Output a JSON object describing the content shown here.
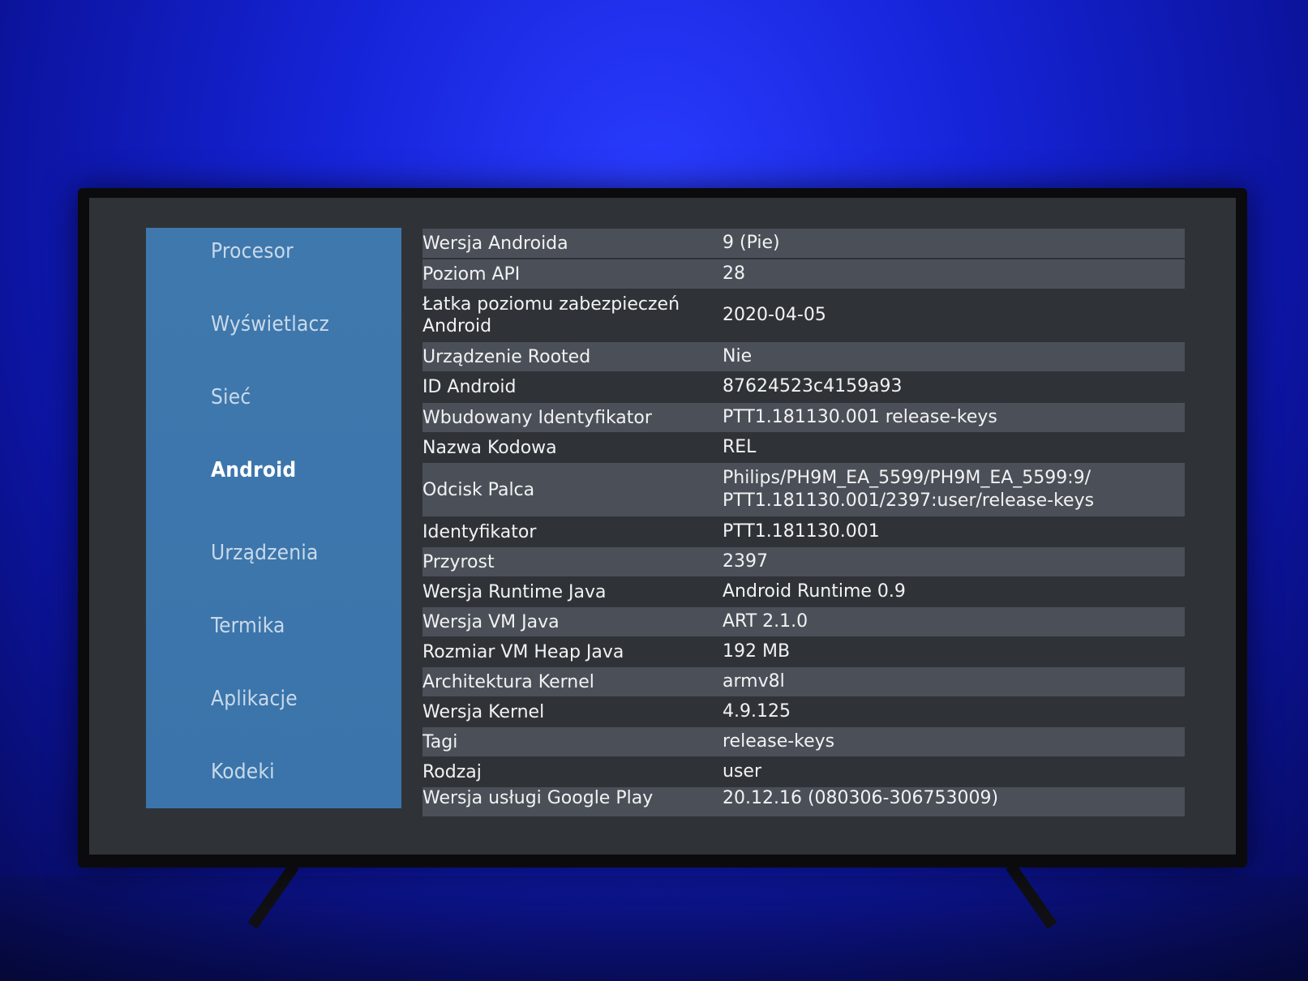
{
  "sidebar": {
    "items": [
      {
        "label": "Procesor",
        "active": false
      },
      {
        "label": "Wyświetlacz",
        "active": false
      },
      {
        "label": "Sieć",
        "active": false
      },
      {
        "label": "Android",
        "active": true
      },
      {
        "label": "Urządzenia",
        "active": false
      },
      {
        "label": "Termika",
        "active": false
      },
      {
        "label": "Aplikacje",
        "active": false
      },
      {
        "label": "Kodeki",
        "active": false
      }
    ]
  },
  "info_table": {
    "rows": [
      {
        "label": "Wersja Androida",
        "value": "9 (Pie)"
      },
      {
        "label": "Poziom API",
        "value": "28"
      },
      {
        "label": "Łatka poziomu zabezpieczeń Android",
        "value": "2020-04-05"
      },
      {
        "label": "Urządzenie Rooted",
        "value": "Nie"
      },
      {
        "label": "ID Android",
        "value": "87624523c4159a93"
      },
      {
        "label": "Wbudowany Identyfikator",
        "value": "PTT1.181130.001 release-keys"
      },
      {
        "label": "Nazwa Kodowa",
        "value": "REL"
      },
      {
        "label": "Odcisk Palca",
        "value": "Philips/PH9M_EA_5599/PH9M_EA_5599:9/ PTT1.181130.001/2397:user/release-keys"
      },
      {
        "label": "Identyfikator",
        "value": "PTT1.181130.001"
      },
      {
        "label": "Przyrost",
        "value": "2397"
      },
      {
        "label": "Wersja Runtime Java",
        "value": "Android Runtime 0.9"
      },
      {
        "label": "Wersja VM Java",
        "value": "ART 2.1.0"
      },
      {
        "label": "Rozmiar VM Heap Java",
        "value": "192 MB"
      },
      {
        "label": "Architektura Kernel",
        "value": "armv8l"
      },
      {
        "label": "Wersja Kernel",
        "value": "4.9.125"
      },
      {
        "label": "Tagi",
        "value": "release-keys"
      },
      {
        "label": "Rodzaj",
        "value": "user"
      },
      {
        "label": "Wersja usługi Google Play",
        "value": "20.12.16 (080306-306753009)"
      }
    ]
  }
}
